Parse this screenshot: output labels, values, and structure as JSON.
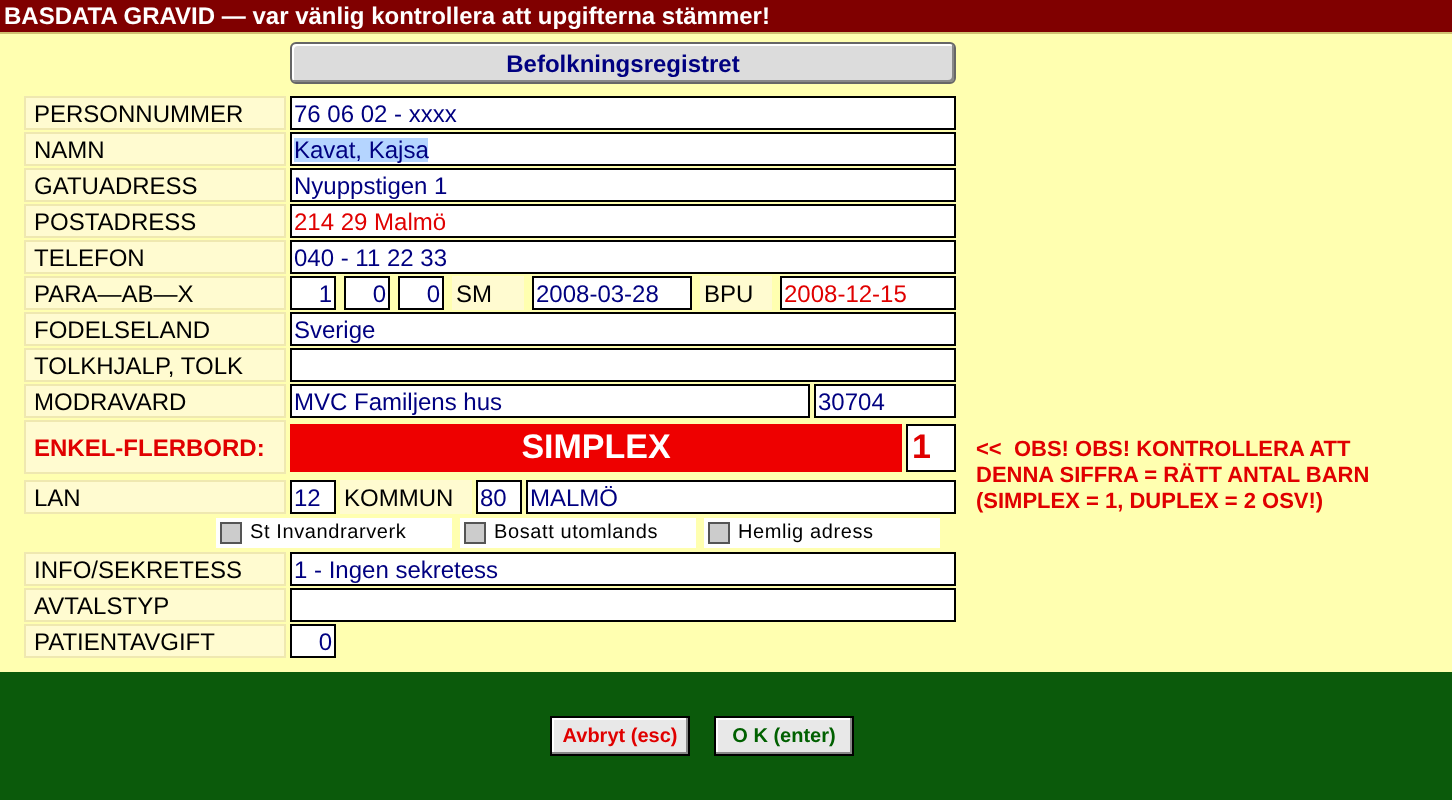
{
  "window": {
    "title": "BASDATA GRAVID — var vänlig kontrollera att upgifterna stämmer!"
  },
  "registry_button": "Befolkningsregistret",
  "rows": [
    {
      "kind": "text",
      "label": "PERSONNUMMER",
      "value": "76 06 02 - xxxx",
      "color": "#000080"
    },
    {
      "kind": "text",
      "label": "NAMN",
      "value": "Kavat, Kajsa",
      "color": "#000080",
      "highlighted": true
    },
    {
      "kind": "text",
      "label": "GATUADRESS",
      "value": "Nyuppstigen 1",
      "color": "#000080"
    },
    {
      "kind": "text",
      "label": "POSTADRESS",
      "value": "214 29 Malmö",
      "color": "#e00000"
    },
    {
      "kind": "text",
      "label": "TELEFON",
      "value": "040 - 11 22 33",
      "color": "#000080"
    },
    {
      "kind": "para",
      "label": "PARA—AB—X",
      "values": [
        "1",
        "0",
        "0"
      ],
      "sm_label": "SM",
      "sm_value": "2008-03-28",
      "bpu_label": "BPU",
      "bpu_value": "2008-12-15"
    },
    {
      "kind": "text",
      "label": "FODELSELAND",
      "value": "Sverige",
      "color": "#000080"
    },
    {
      "kind": "text",
      "label": "TOLKHJALP, TOLK"
    },
    {
      "kind": "split",
      "label": "MODRAVARD",
      "value": "MVC Familjens hus",
      "code": "30704"
    },
    {
      "kind": "alert",
      "label": "ENKEL-FLERBORD:",
      "banner": "SIMPLEX",
      "count": "1"
    },
    {
      "kind": "lan",
      "label": "LAN",
      "value": "12",
      "kommun_label": "KOMMUN",
      "kommun_code": "80",
      "kommun_name": "MALMÖ"
    },
    {
      "kind": "checks",
      "items": [
        {
          "label": "St Invandrarverk",
          "checked": false
        },
        {
          "label": "Bosatt utomlands",
          "checked": false
        },
        {
          "label": "Hemlig adress",
          "checked": false
        }
      ]
    },
    {
      "kind": "text",
      "label": "INFO/SEKRETESS",
      "value": "1 - Ingen sekretess",
      "color": "#000080"
    },
    {
      "kind": "text",
      "label": "AVTALSTYP"
    },
    {
      "kind": "short",
      "label": "PATIENTAVGIFT",
      "value": "0"
    }
  ],
  "note": "<<  OBS! OBS! KONTROLLERA ATT DENNA SIFFRA = RÄTT ANTAL BARN (SIMPLEX = 1, DUPLEX = 2 OSV!)",
  "buttons": [
    {
      "kind": "cancel",
      "label": "Avbryt (esc)"
    },
    {
      "kind": "ok",
      "label": "O K (enter)"
    }
  ]
}
